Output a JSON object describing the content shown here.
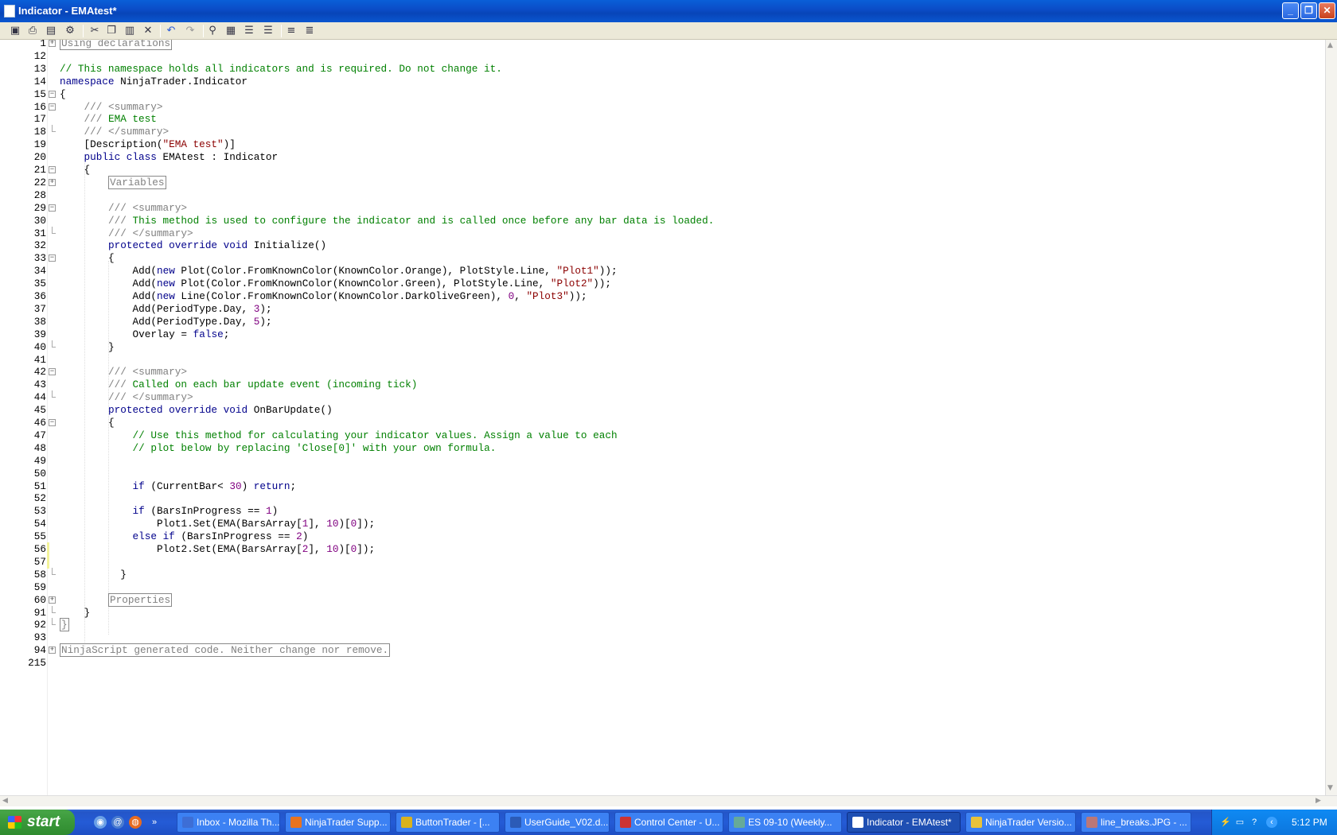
{
  "window": {
    "title": "Indicator - EMAtest*"
  },
  "toolbar": {
    "icons": [
      "save-icon",
      "print-icon",
      "print-preview-icon",
      "compile-icon",
      "cut-icon",
      "copy-icon",
      "paste-icon",
      "delete-icon",
      "undo-icon",
      "redo-icon",
      "find-icon",
      "find-replace-icon",
      "indent-icon",
      "outdent-icon",
      "comment-icon",
      "uncomment-icon"
    ]
  },
  "editor": {
    "lines": [
      {
        "n": "1",
        "fold": "plus",
        "indent": 0,
        "segs": [
          {
            "c": "box",
            "t": "Using declarations"
          }
        ]
      },
      {
        "n": "12",
        "indent": 0,
        "segs": []
      },
      {
        "n": "13",
        "indent": 0,
        "segs": [
          {
            "c": "cm",
            "t": "// This namespace holds all indicators and is required. Do not change it."
          }
        ]
      },
      {
        "n": "14",
        "indent": 0,
        "segs": [
          {
            "c": "kw",
            "t": "namespace"
          },
          {
            "c": "",
            "t": " NinjaTrader.Indicator"
          }
        ]
      },
      {
        "n": "15",
        "fold": "minus",
        "indent": 0,
        "segs": [
          {
            "c": "",
            "t": "{"
          }
        ]
      },
      {
        "n": "16",
        "fold": "minus",
        "indent": 1,
        "segs": [
          {
            "c": "cg",
            "t": "/// <summary>"
          }
        ]
      },
      {
        "n": "17",
        "indent": 1,
        "segs": [
          {
            "c": "cg",
            "t": "/// "
          },
          {
            "c": "cm",
            "t": "EMA test"
          }
        ]
      },
      {
        "n": "18",
        "fold": "end",
        "indent": 1,
        "segs": [
          {
            "c": "cg",
            "t": "/// </summary>"
          }
        ]
      },
      {
        "n": "19",
        "indent": 1,
        "segs": [
          {
            "c": "",
            "t": "[Description("
          },
          {
            "c": "st",
            "t": "\"EMA test\""
          },
          {
            "c": "",
            "t": ")]"
          }
        ]
      },
      {
        "n": "20",
        "indent": 1,
        "segs": [
          {
            "c": "kw",
            "t": "public class"
          },
          {
            "c": "",
            "t": " EMAtest : Indicator"
          }
        ]
      },
      {
        "n": "21",
        "fold": "minus",
        "indent": 1,
        "segs": [
          {
            "c": "",
            "t": "{"
          }
        ]
      },
      {
        "n": "22",
        "fold": "plus",
        "indent": 2,
        "segs": [
          {
            "c": "box",
            "t": "Variables"
          }
        ]
      },
      {
        "n": "28",
        "indent": 0,
        "segs": []
      },
      {
        "n": "29",
        "fold": "minus",
        "indent": 2,
        "segs": [
          {
            "c": "cg",
            "t": "/// <summary>"
          }
        ]
      },
      {
        "n": "30",
        "indent": 2,
        "segs": [
          {
            "c": "cg",
            "t": "/// "
          },
          {
            "c": "cm",
            "t": "This method is used to configure the indicator and is called once before any bar data is loaded."
          }
        ]
      },
      {
        "n": "31",
        "fold": "end",
        "indent": 2,
        "segs": [
          {
            "c": "cg",
            "t": "/// </summary>"
          }
        ]
      },
      {
        "n": "32",
        "indent": 2,
        "segs": [
          {
            "c": "kw",
            "t": "protected override void"
          },
          {
            "c": "",
            "t": " Initialize()"
          }
        ]
      },
      {
        "n": "33",
        "fold": "minus",
        "indent": 2,
        "segs": [
          {
            "c": "",
            "t": "{"
          }
        ]
      },
      {
        "n": "34",
        "indent": 3,
        "segs": [
          {
            "c": "",
            "t": "Add("
          },
          {
            "c": "kw",
            "t": "new"
          },
          {
            "c": "",
            "t": " Plot(Color.FromKnownColor(KnownColor.Orange), PlotStyle.Line, "
          },
          {
            "c": "st",
            "t": "\"Plot1\""
          },
          {
            "c": "",
            "t": "));"
          }
        ]
      },
      {
        "n": "35",
        "indent": 3,
        "segs": [
          {
            "c": "",
            "t": "Add("
          },
          {
            "c": "kw",
            "t": "new"
          },
          {
            "c": "",
            "t": " Plot(Color.FromKnownColor(KnownColor.Green), PlotStyle.Line, "
          },
          {
            "c": "st",
            "t": "\"Plot2\""
          },
          {
            "c": "",
            "t": "));"
          }
        ]
      },
      {
        "n": "36",
        "indent": 3,
        "segs": [
          {
            "c": "",
            "t": "Add("
          },
          {
            "c": "kw",
            "t": "new"
          },
          {
            "c": "",
            "t": " Line(Color.FromKnownColor(KnownColor.DarkOliveGreen), "
          },
          {
            "c": "nm",
            "t": "0"
          },
          {
            "c": "",
            "t": ", "
          },
          {
            "c": "st",
            "t": "\"Plot3\""
          },
          {
            "c": "",
            "t": "));"
          }
        ]
      },
      {
        "n": "37",
        "indent": 3,
        "segs": [
          {
            "c": "",
            "t": "Add(PeriodType.Day, "
          },
          {
            "c": "nm",
            "t": "3"
          },
          {
            "c": "",
            "t": ");"
          }
        ]
      },
      {
        "n": "38",
        "indent": 3,
        "segs": [
          {
            "c": "",
            "t": "Add(PeriodType.Day, "
          },
          {
            "c": "nm",
            "t": "5"
          },
          {
            "c": "",
            "t": ");"
          }
        ]
      },
      {
        "n": "39",
        "indent": 3,
        "segs": [
          {
            "c": "",
            "t": "Overlay = "
          },
          {
            "c": "kw",
            "t": "false"
          },
          {
            "c": "",
            "t": ";"
          }
        ]
      },
      {
        "n": "40",
        "fold": "end",
        "indent": 2,
        "segs": [
          {
            "c": "",
            "t": "}"
          }
        ]
      },
      {
        "n": "41",
        "indent": 0,
        "segs": []
      },
      {
        "n": "42",
        "fold": "minus",
        "indent": 2,
        "segs": [
          {
            "c": "cg",
            "t": "/// <summary>"
          }
        ]
      },
      {
        "n": "43",
        "indent": 2,
        "segs": [
          {
            "c": "cg",
            "t": "/// "
          },
          {
            "c": "cm",
            "t": "Called on each bar update event (incoming tick)"
          }
        ]
      },
      {
        "n": "44",
        "fold": "end",
        "indent": 2,
        "segs": [
          {
            "c": "cg",
            "t": "/// </summary>"
          }
        ]
      },
      {
        "n": "45",
        "indent": 2,
        "segs": [
          {
            "c": "kw",
            "t": "protected override void"
          },
          {
            "c": "",
            "t": " OnBarUpdate()"
          }
        ]
      },
      {
        "n": "46",
        "fold": "minus",
        "indent": 2,
        "segs": [
          {
            "c": "",
            "t": "{"
          }
        ]
      },
      {
        "n": "47",
        "indent": 3,
        "segs": [
          {
            "c": "cm",
            "t": "// Use this method for calculating your indicator values. Assign a value to each"
          }
        ]
      },
      {
        "n": "48",
        "indent": 3,
        "segs": [
          {
            "c": "cm",
            "t": "// plot below by replacing 'Close[0]' with your own formula."
          }
        ]
      },
      {
        "n": "49",
        "indent": 0,
        "segs": []
      },
      {
        "n": "50",
        "indent": 0,
        "segs": []
      },
      {
        "n": "51",
        "indent": 3,
        "segs": [
          {
            "c": "kw",
            "t": "if"
          },
          {
            "c": "",
            "t": " (CurrentBar< "
          },
          {
            "c": "nm",
            "t": "30"
          },
          {
            "c": "",
            "t": ") "
          },
          {
            "c": "kw",
            "t": "return"
          },
          {
            "c": "",
            "t": ";"
          }
        ]
      },
      {
        "n": "52",
        "indent": 0,
        "segs": []
      },
      {
        "n": "53",
        "indent": 3,
        "segs": [
          {
            "c": "kw",
            "t": "if"
          },
          {
            "c": "",
            "t": " (BarsInProgress == "
          },
          {
            "c": "nm",
            "t": "1"
          },
          {
            "c": "",
            "t": ")"
          }
        ]
      },
      {
        "n": "54",
        "indent": 4,
        "segs": [
          {
            "c": "",
            "t": "Plot1.Set(EMA(BarsArray["
          },
          {
            "c": "nm",
            "t": "1"
          },
          {
            "c": "",
            "t": "], "
          },
          {
            "c": "nm",
            "t": "10"
          },
          {
            "c": "",
            "t": ")["
          },
          {
            "c": "nm",
            "t": "0"
          },
          {
            "c": "",
            "t": "]);"
          }
        ]
      },
      {
        "n": "55",
        "indent": 3,
        "segs": [
          {
            "c": "kw",
            "t": "else if"
          },
          {
            "c": "",
            "t": " (BarsInProgress == "
          },
          {
            "c": "nm",
            "t": "2"
          },
          {
            "c": "",
            "t": ")"
          }
        ]
      },
      {
        "n": "56",
        "changed": true,
        "indent": 4,
        "segs": [
          {
            "c": "",
            "t": "Plot2.Set(EMA(BarsArray["
          },
          {
            "c": "nm",
            "t": "2"
          },
          {
            "c": "",
            "t": "], "
          },
          {
            "c": "nm",
            "t": "10"
          },
          {
            "c": "",
            "t": ")["
          },
          {
            "c": "nm",
            "t": "0"
          },
          {
            "c": "",
            "t": "]);"
          }
        ]
      },
      {
        "n": "57",
        "changed": true,
        "indent": 0,
        "segs": []
      },
      {
        "n": "58",
        "fold": "end",
        "indent": 2,
        "segs": [
          {
            "c": "",
            "t": "  }"
          }
        ]
      },
      {
        "n": "59",
        "indent": 0,
        "segs": []
      },
      {
        "n": "60",
        "fold": "plus",
        "indent": 2,
        "segs": [
          {
            "c": "box",
            "t": "Properties"
          }
        ]
      },
      {
        "n": "91",
        "fold": "end",
        "indent": 1,
        "segs": [
          {
            "c": "",
            "t": "}"
          }
        ]
      },
      {
        "n": "92",
        "fold": "end",
        "indent": 0,
        "segs": [
          {
            "c": "box",
            "t": "}"
          }
        ]
      },
      {
        "n": "93",
        "indent": 0,
        "segs": []
      },
      {
        "n": "94",
        "fold": "plus",
        "indent": 0,
        "segs": [
          {
            "c": "box",
            "t": "NinjaScript generated code. Neither change nor remove."
          }
        ]
      },
      {
        "n": "215",
        "indent": 0,
        "segs": []
      }
    ]
  },
  "taskbar": {
    "start_label": "start",
    "tasks": [
      {
        "label": "Inbox - Mozilla Th...",
        "icon": "thunderbird-icon",
        "active": false
      },
      {
        "label": "NinjaTrader Supp...",
        "icon": "firefox-icon",
        "active": false
      },
      {
        "label": "ButtonTrader - [...",
        "icon": "buttontrader-icon",
        "active": false
      },
      {
        "label": "UserGuide_V02.d...",
        "icon": "word-icon",
        "active": false
      },
      {
        "label": "Control Center - U...",
        "icon": "ninjatrader-icon",
        "active": false
      },
      {
        "label": "ES 09-10 (Weekly...",
        "icon": "chart-icon",
        "active": false
      },
      {
        "label": "Indicator - EMAtest*",
        "icon": "document-icon",
        "active": true
      },
      {
        "label": "NinjaTrader Versio...",
        "icon": "help-icon",
        "active": false
      },
      {
        "label": "line_breaks.JPG - ...",
        "icon": "paint-icon",
        "active": false
      }
    ],
    "clock": "5:12 PM"
  }
}
